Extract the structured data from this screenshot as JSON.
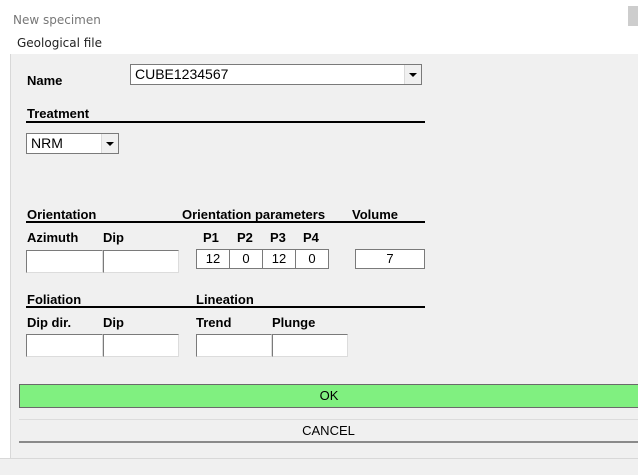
{
  "window": {
    "title": "New specimen"
  },
  "menu": {
    "items": [
      "Geological file"
    ]
  },
  "form": {
    "name_label": "Name",
    "name_value": "CUBE1234567",
    "treatment_label": "Treatment",
    "treatment_value": "NRM",
    "orientation_label": "Orientation",
    "orientation_params_label": "Orientation parameters",
    "volume_label": "Volume",
    "azimuth_label": "Azimuth",
    "dip_label": "Dip",
    "azimuth_value": "",
    "dip_value": "",
    "p1_label": "P1",
    "p2_label": "P2",
    "p3_label": "P3",
    "p4_label": "P4",
    "p1_value": "12",
    "p2_value": "0",
    "p3_value": "12",
    "p4_value": "0",
    "volume_value": "7",
    "foliation_label": "Foliation",
    "lineation_label": "Lineation",
    "dipdir_label": "Dip dir.",
    "fol_dip_label": "Dip",
    "trend_label": "Trend",
    "plunge_label": "Plunge",
    "dipdir_value": "",
    "fol_dip_value": "",
    "trend_value": "",
    "plunge_value": ""
  },
  "buttons": {
    "ok": "OK",
    "cancel": "CANCEL"
  },
  "colors": {
    "ok_button": "#80f080",
    "panel": "#f0f0f0"
  }
}
